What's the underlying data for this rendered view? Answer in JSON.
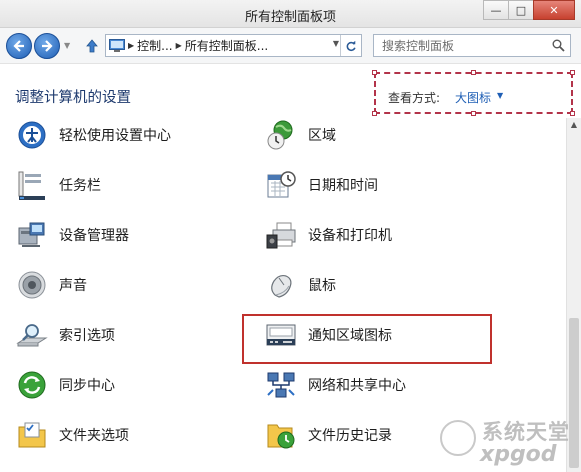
{
  "window": {
    "title": "所有控制面板项",
    "minimize_glyph": "—",
    "maximize_glyph": "□",
    "close_glyph": "✕"
  },
  "address_bar": {
    "crumbs": [
      "控制...",
      "所有控制面板..."
    ],
    "search_placeholder": "搜索控制面板"
  },
  "header": {
    "title": "调整计算机的设置",
    "view_by_label": "查看方式:",
    "view_by_value": "大图标"
  },
  "items": {
    "left": [
      {
        "label": "轻松使用设置中心",
        "icon": "ease-of-access-icon"
      },
      {
        "label": "任务栏",
        "icon": "taskbar-icon"
      },
      {
        "label": "设备管理器",
        "icon": "device-manager-icon"
      },
      {
        "label": "声音",
        "icon": "sound-icon"
      },
      {
        "label": "索引选项",
        "icon": "indexing-options-icon"
      },
      {
        "label": "同步中心",
        "icon": "sync-center-icon"
      },
      {
        "label": "文件夹选项",
        "icon": "folder-options-icon"
      }
    ],
    "right": [
      {
        "label": "区域",
        "icon": "region-icon"
      },
      {
        "label": "日期和时间",
        "icon": "date-time-icon"
      },
      {
        "label": "设备和打印机",
        "icon": "devices-printers-icon"
      },
      {
        "label": "鼠标",
        "icon": "mouse-icon"
      },
      {
        "label": "通知区域图标",
        "icon": "notification-area-icon"
      },
      {
        "label": "网络和共享中心",
        "icon": "network-sharing-icon"
      },
      {
        "label": "文件历史记录",
        "icon": "file-history-icon"
      }
    ]
  },
  "watermark": {
    "line1": "系统天堂",
    "line2": "xpgod"
  },
  "colors": {
    "accent_blue": "#1f5fb5",
    "highlight_red": "#c0312d",
    "heading_blue": "#1e3a6e"
  }
}
